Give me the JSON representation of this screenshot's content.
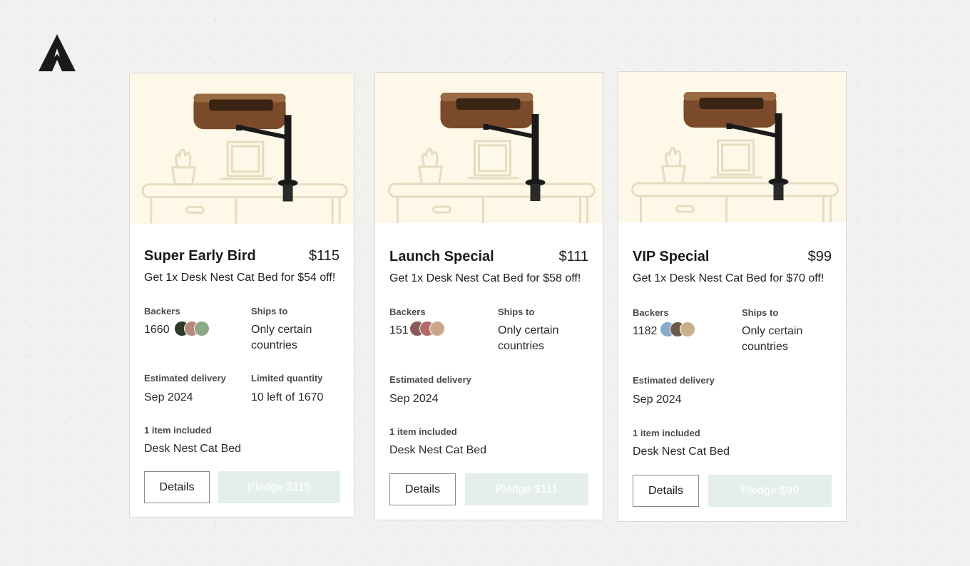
{
  "logo": {
    "icon": "kickstarter-arrow-logo-icon"
  },
  "colors": {
    "image_bg": "#fdf8e7",
    "pledge_bg": "#e5efe9",
    "wood": "#7a4a2a",
    "stand": "#1a1a1a"
  },
  "rewards": [
    {
      "title": "Super Early Bird",
      "price": "$115",
      "description": "Get 1x Desk Nest Cat Bed for $54 off!",
      "backers_label": "Backers",
      "backers_count": "1660",
      "ships_label": "Ships to",
      "ships_value": "Only certain countries",
      "delivery_label": "Estimated delivery",
      "delivery_value": "Sep 2024",
      "limited_label": "Limited quantity",
      "limited_value": "10 left of 1670",
      "items_label": "1 item included",
      "item_name": "Desk Nest Cat Bed",
      "details_label": "Details",
      "pledge_label": "Pledge $115"
    },
    {
      "title": "Launch Special",
      "price": "$111",
      "description": "Get 1x Desk Nest Cat Bed for $58 off!",
      "backers_label": "Backers",
      "backers_count": "151",
      "ships_label": "Ships to",
      "ships_value": "Only certain countries",
      "delivery_label": "Estimated delivery",
      "delivery_value": "Sep 2024",
      "items_label": "1 item included",
      "item_name": "Desk Nest Cat Bed",
      "details_label": "Details",
      "pledge_label": "Pledge $111"
    },
    {
      "title": "VIP Special",
      "price": "$99",
      "description": "Get 1x Desk Nest Cat Bed for $70 off!",
      "backers_label": "Backers",
      "backers_count": "1182",
      "ships_label": "Ships to",
      "ships_value": "Only certain countries",
      "delivery_label": "Estimated delivery",
      "delivery_value": "Sep 2024",
      "items_label": "1 item included",
      "item_name": "Desk Nest Cat Bed",
      "details_label": "Details",
      "pledge_label": "Pledge $99"
    }
  ]
}
